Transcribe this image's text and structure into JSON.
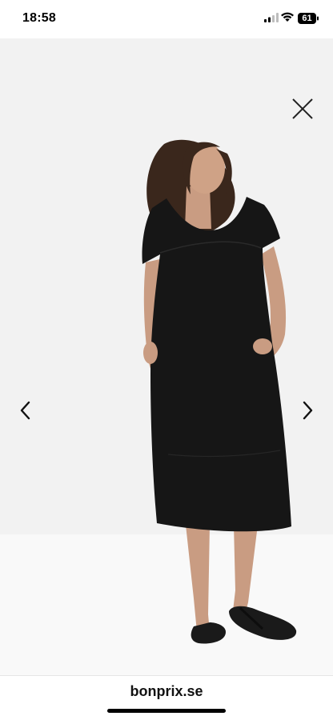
{
  "status_bar": {
    "time": "18:58",
    "battery_level": "61",
    "icons": [
      "signal-icon",
      "wifi-icon",
      "battery-icon"
    ]
  },
  "viewer": {
    "background": "#f2f2f2",
    "image": "model-in-black-short-sleeve-midi-dress",
    "icons": [
      "close-icon",
      "chevron-left-icon",
      "chevron-right-icon"
    ]
  },
  "bottom_bar": {
    "site_url": "bonprix.se"
  },
  "colors": {
    "dress": "#161616",
    "hair": "#3a271c",
    "skin": "#c99c82"
  }
}
